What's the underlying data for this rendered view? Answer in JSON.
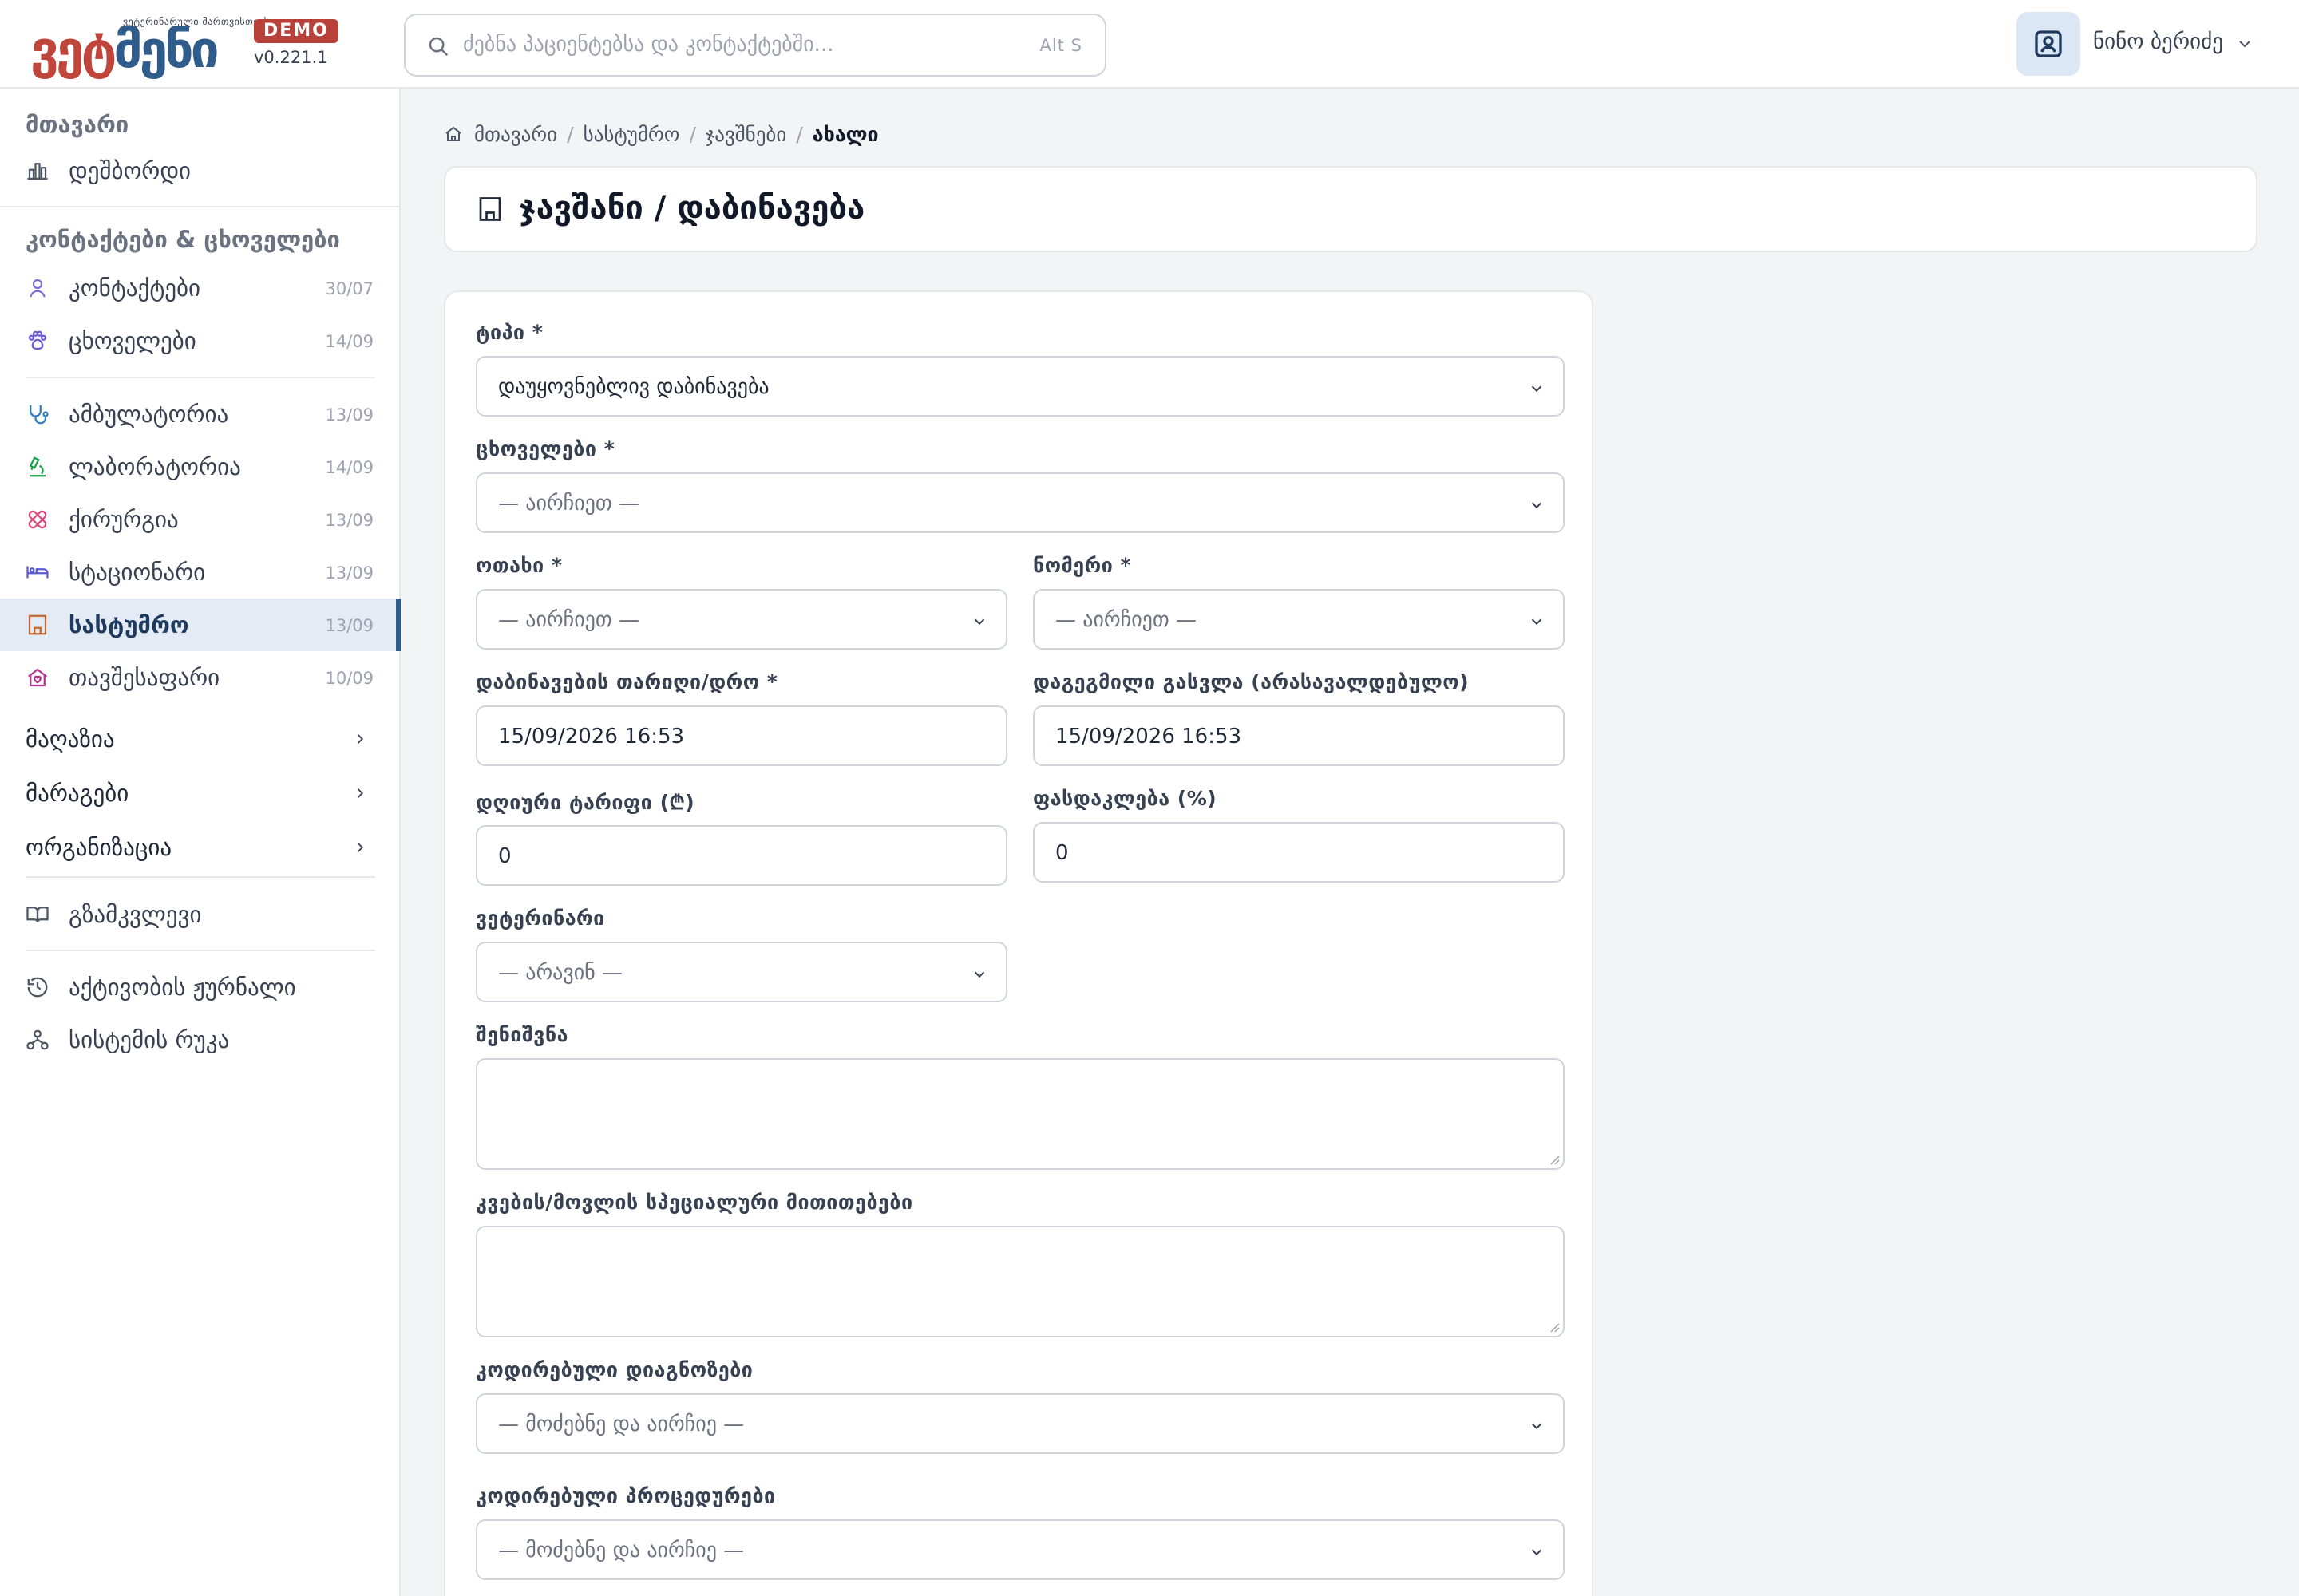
{
  "header": {
    "logo_text_red": "ვეტ",
    "logo_text_blue": "მენი",
    "logo_tagline": "ვეტერინარული მართვისთვის",
    "demo_badge": "DEMO",
    "version": "v0.221.1",
    "search_placeholder": "ძებნა პაციენტებსა და კონტაქტებში...",
    "search_shortcut": "Alt S",
    "user_name": "ნინო ბერიძე"
  },
  "sidebar": {
    "main_title": "მთავარი",
    "dashboard": "დეშბორდი",
    "contacts_section_title": "კონტაქტები & ცხოველები",
    "items": [
      {
        "label": "კონტაქტები",
        "count": "30/07"
      },
      {
        "label": "ცხოველები",
        "count": "14/09"
      },
      {
        "label": "ამბულატორია",
        "count": "13/09"
      },
      {
        "label": "ლაბორატორია",
        "count": "14/09"
      },
      {
        "label": "ქირურგია",
        "count": "13/09"
      },
      {
        "label": "სტაციონარი",
        "count": "13/09"
      },
      {
        "label": "სასტუმრო",
        "count": "13/09"
      },
      {
        "label": "თავშესაფარი",
        "count": "10/09"
      }
    ],
    "groups": [
      "მაღაზია",
      "მარაგები",
      "ორგანიზაცია"
    ],
    "guide": "გზამკვლევი",
    "activity_log": "აქტივობის ჟურნალი",
    "system_map": "სისტემის რუკა"
  },
  "breadcrumb": {
    "home": "მთავარი",
    "hotel": "სასტუმრო",
    "bookings": "ჯავშნები",
    "current": "ახალი"
  },
  "page_title": "ჯავშანი / დაბინავება",
  "form": {
    "type_label": "ტიპი *",
    "type_value": "დაუყოვნებლივ დაბინავება",
    "animals_label": "ცხოველები *",
    "animals_placeholder": "— აირჩიეთ —",
    "room_label": "ოთახი *",
    "room_placeholder": "— აირჩიეთ —",
    "number_label": "ნომერი *",
    "number_placeholder": "— აირჩიეთ —",
    "checkin_label": "დაბინავების თარიღი/დრო *",
    "checkin_value": "15/09/2026 16:53",
    "checkout_label": "დაგეგმილი გასვლა (არასავალდებულო)",
    "checkout_value": "15/09/2026 16:53",
    "daily_rate_label": "დღიური ტარიფი (₾)",
    "daily_rate_value": "0",
    "discount_label": "ფასდაკლება (%)",
    "discount_value": "0",
    "vet_label": "ვეტერინარი",
    "vet_placeholder": "— არავინ —",
    "notes_label": "შენიშვნა",
    "feeding_label": "კვების/მოვლის სპეციალური მითითებები",
    "diagnoses_label": "კოდირებული დიაგნოზები",
    "diagnoses_placeholder": "— მოძებნე და აირჩიე —",
    "procedures_label": "კოდირებული პროცედურები",
    "procedures_placeholder": "— მოძებნე და აირჩიე —"
  },
  "colors": {
    "brand_red": "#c0453a",
    "brand_blue": "#2f5c8a",
    "active_bg": "#e4ebf5"
  }
}
